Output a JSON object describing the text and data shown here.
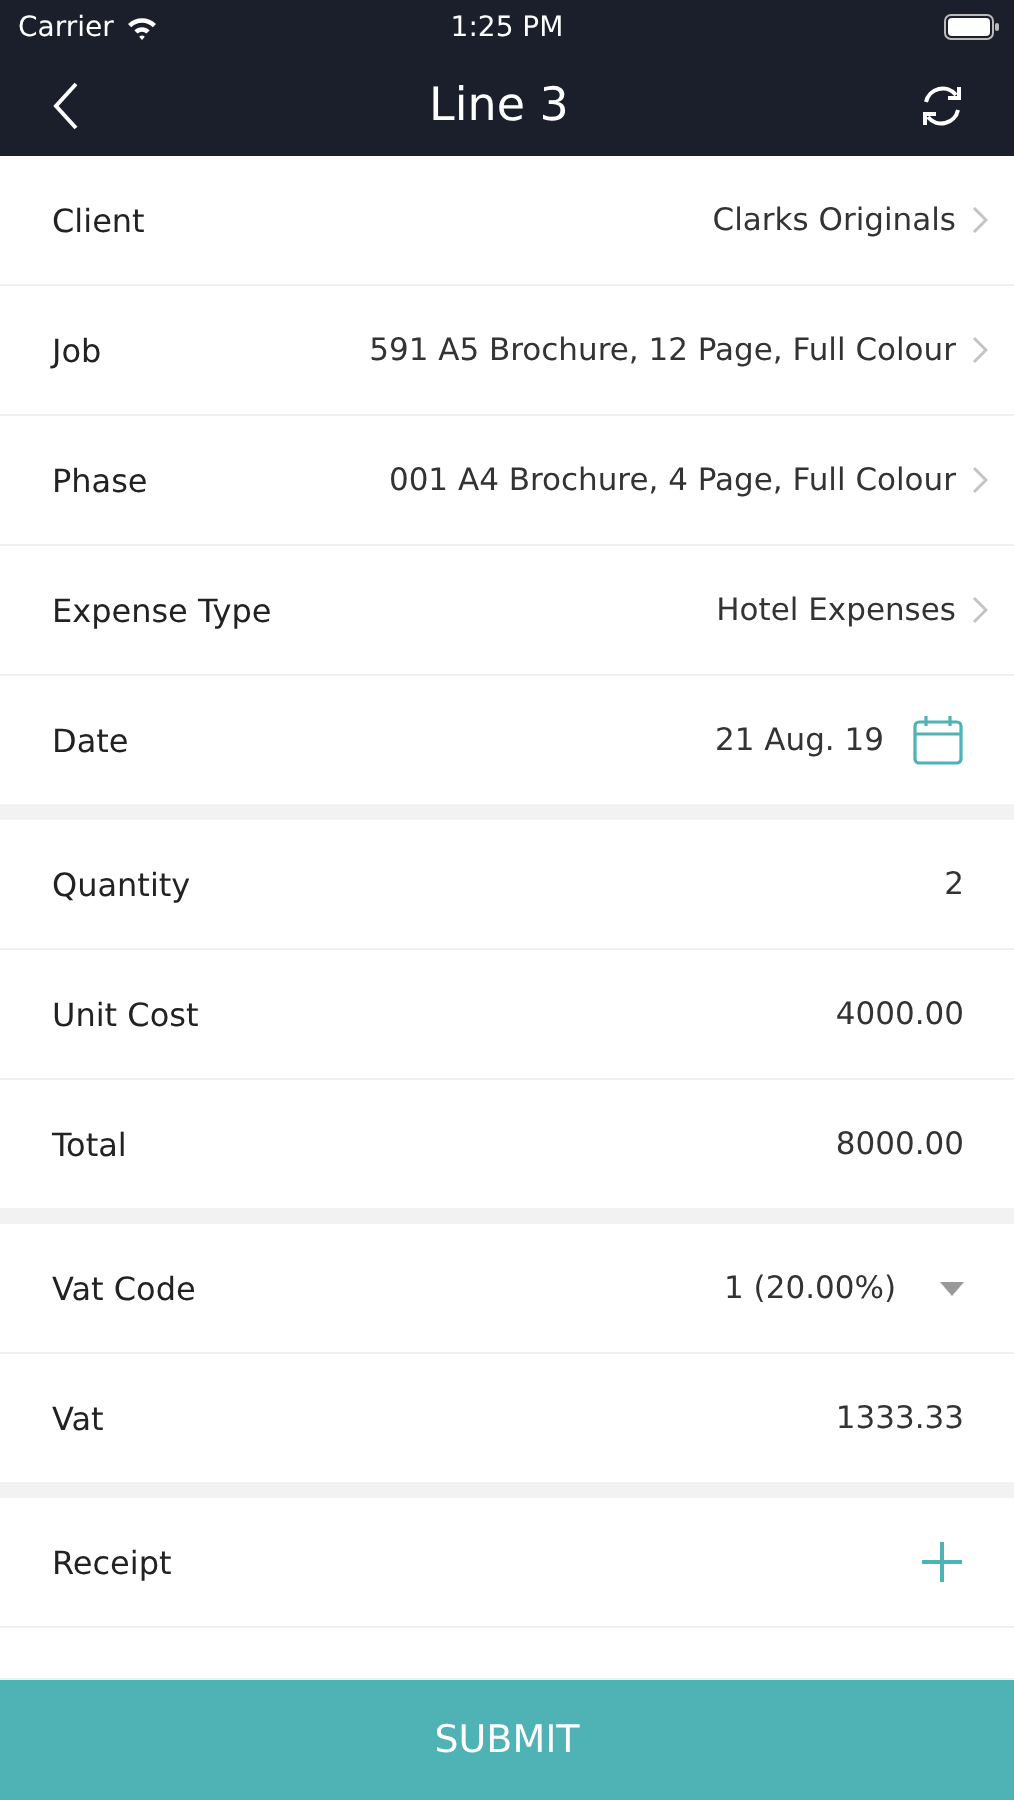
{
  "status_bar": {
    "carrier": "Carrier",
    "time": "1:25 PM"
  },
  "nav": {
    "title": "Line 3"
  },
  "sections": [
    [
      {
        "kind": "select",
        "label": "Client",
        "value": "Clarks Originals"
      },
      {
        "kind": "select",
        "label": "Job",
        "value": "591 A5 Brochure, 12 Page, Full Colour"
      },
      {
        "kind": "select",
        "label": "Phase",
        "value": "001 A4 Brochure, 4 Page, Full Colour"
      },
      {
        "kind": "select",
        "label": "Expense Type",
        "value": "Hotel Expenses"
      },
      {
        "kind": "date",
        "label": "Date",
        "value": "21 Aug. 19"
      }
    ],
    [
      {
        "kind": "value",
        "label": "Quantity",
        "value": "2"
      },
      {
        "kind": "value",
        "label": "Unit Cost",
        "value": "4000.00"
      },
      {
        "kind": "value",
        "label": "Total",
        "value": "8000.00"
      }
    ],
    [
      {
        "kind": "dropdown",
        "label": "Vat Code",
        "value": "1 (20.00%)"
      },
      {
        "kind": "value",
        "label": "Vat",
        "value": "1333.33"
      }
    ],
    [
      {
        "kind": "add",
        "label": "Receipt"
      }
    ]
  ],
  "submit": {
    "label": "SUBMIT"
  }
}
